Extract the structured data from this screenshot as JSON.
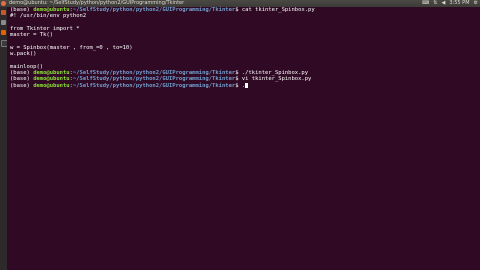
{
  "topbar": {
    "title": "demo@ubuntu: ~/SelfStudy/python/python2/GUIProgramming/Tkinter",
    "clock": "3:55 PM",
    "tray_icons": [
      "keyboard-icon",
      "network-icon",
      "volume-icon",
      "battery-icon"
    ]
  },
  "launcher": {
    "items": [
      "dash-icon",
      "files-icon",
      "firefox-icon",
      "terminal-icon"
    ]
  },
  "terminal": {
    "lines": [
      {
        "prompt_env": "(base) ",
        "user": "demo@ubuntu",
        "path": ":~/SelfStudy/python/python2/GUIProgramming/Tkinter",
        "symbol": "$ ",
        "cmd": "cat tkinter_Spinbox.py"
      },
      {
        "text": "#! /usr/bin/env python2"
      },
      {
        "text": ""
      },
      {
        "text": "from Tkinter import *"
      },
      {
        "text": "master = Tk()"
      },
      {
        "text": ""
      },
      {
        "text": "w = Spinbox(master , from_=0 , to=10)"
      },
      {
        "text": "w.pack()"
      },
      {
        "text": ""
      },
      {
        "text": "mainloop()"
      },
      {
        "prompt_env": "(base) ",
        "user": "demo@ubuntu",
        "path": ":~/SelfStudy/python/python2/GUIProgramming/Tkinter",
        "symbol": "$ ",
        "cmd": "./tkinter_Spinbox.py"
      },
      {
        "prompt_env": "(base) ",
        "user": "demo@ubuntu",
        "path": ":~/SelfStudy/python/python2/GUIProgramming/Tkinter",
        "symbol": "$ ",
        "cmd": "vi tkinter_Spinbox.py"
      },
      {
        "prompt_env": "(base) ",
        "user": "demo@ubuntu",
        "path": ":~/SelfStudy/python/python2/GUIProgramming/Tkinter",
        "symbol": "$ ",
        "cmd": ".",
        "cursor": true
      }
    ]
  },
  "colors": {
    "background": "#300a24",
    "user": "#8ae234",
    "path": "#729fcf",
    "text": "#ffffff"
  }
}
